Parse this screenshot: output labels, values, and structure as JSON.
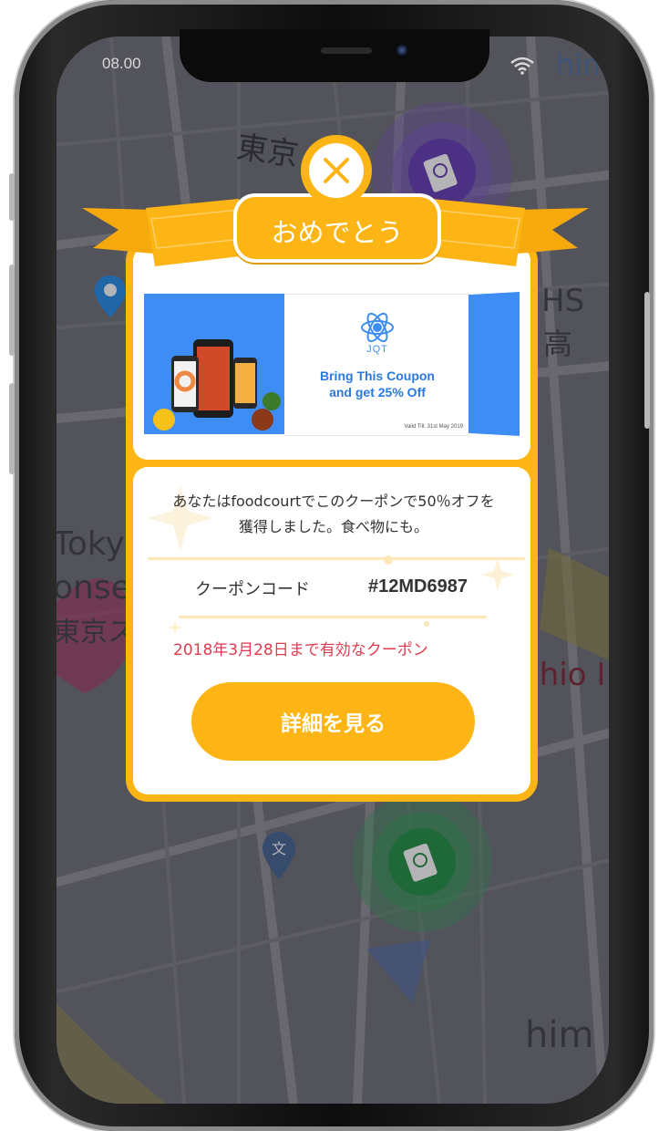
{
  "status_bar": {
    "time": "08.00"
  },
  "map": {
    "labels": [
      "東京",
      "HS",
      "Toky",
      "onse",
      "東京ス",
      "shio I",
      "him",
      "高",
      "hime",
      "文"
    ]
  },
  "popup": {
    "title": "おめでとう",
    "coupon_image": {
      "brand": "JQT",
      "headline_line1": "Bring This Coupon",
      "headline_line2": "and get 25% Off",
      "valid_text": "Valid Till: 31st May 2019"
    },
    "description_line1": "あなたはfoodcourtでこのクーポンで50％オフを",
    "description_line2": "獲得しました。食べ物にも。",
    "coupon_code_label": "クーポンコード",
    "coupon_code": "#12MD6987",
    "validity": "2018年3月28日まで有効なクーポン",
    "details_button": "詳細を見る"
  },
  "colors": {
    "accent": "#fdb515",
    "validity_text": "#e03a50",
    "coupon_blue": "#3d8df5",
    "map_pin_blue": "#1e88e5",
    "coupon_pin_purple": "#5e35b1",
    "coupon_pin_green": "#1b8a3c"
  },
  "icons": [
    "close-icon",
    "wifi-icon",
    "location-pin-icon",
    "coupon-pin-icon",
    "school-pin-icon",
    "atom-logo-icon"
  ]
}
